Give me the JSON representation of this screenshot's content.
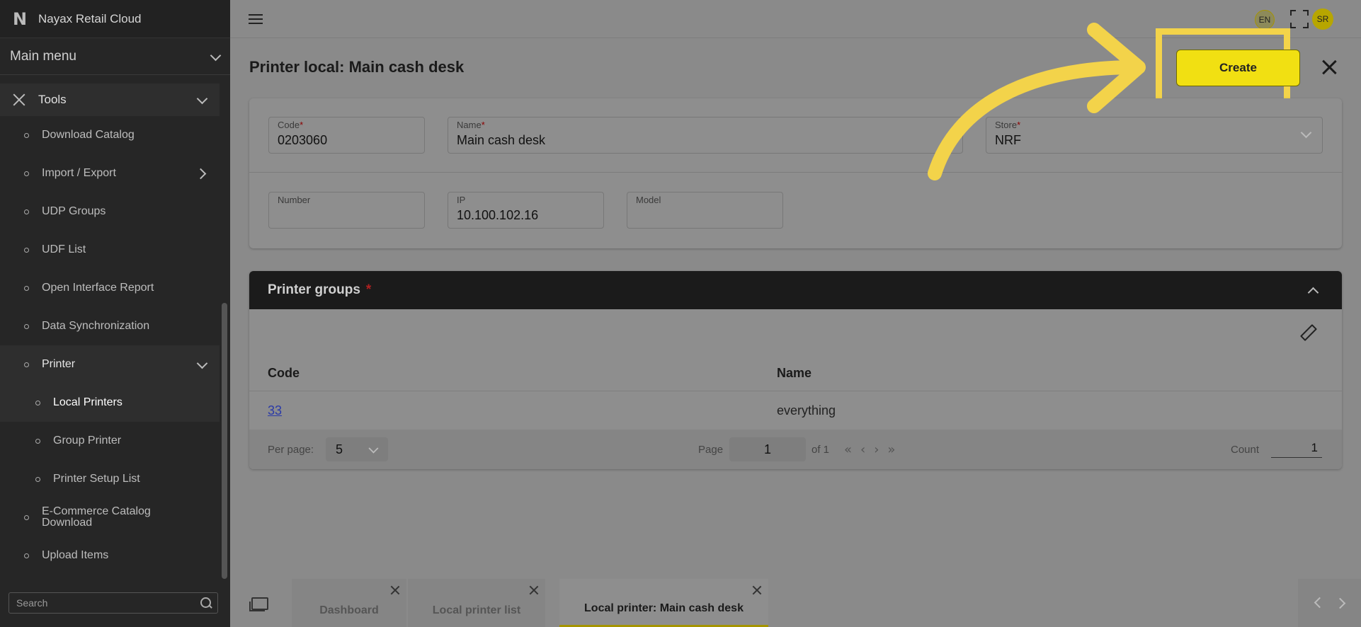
{
  "brand": {
    "name": "Nayax Retail Cloud",
    "logo_letter": "N"
  },
  "sidebar": {
    "main_menu_label": "Main menu",
    "tools_label": "Tools",
    "items": [
      {
        "label": "Download Catalog"
      },
      {
        "label": "Import / Export"
      },
      {
        "label": "UDP Groups"
      },
      {
        "label": "UDF List"
      },
      {
        "label": "Open Interface Report"
      },
      {
        "label": "Data Synchronization"
      },
      {
        "label": "Printer"
      },
      {
        "label": "Local Printers"
      },
      {
        "label": "Group Printer"
      },
      {
        "label": "Printer Setup List"
      },
      {
        "label": "E-Commerce Catalog Download"
      },
      {
        "label": "Upload Items"
      }
    ],
    "search_placeholder": "Search"
  },
  "topbar": {
    "lang": "EN",
    "avatar": "SR"
  },
  "page": {
    "title": "Printer local: Main cash desk",
    "create_label": "Create"
  },
  "form": {
    "code": {
      "label": "Code",
      "value": "0203060"
    },
    "name": {
      "label": "Name",
      "value": "Main cash desk"
    },
    "store": {
      "label": "Store",
      "value": "NRF"
    },
    "number": {
      "label": "Number",
      "value": ""
    },
    "ip": {
      "label": "IP",
      "value": "10.100.102.16"
    },
    "model": {
      "label": "Model",
      "value": ""
    },
    "required_mark": "*"
  },
  "groups": {
    "title": "Printer groups",
    "required_mark": "*",
    "columns": {
      "code": "Code",
      "name": "Name"
    },
    "rows": [
      {
        "code": "33",
        "name": "everything"
      }
    ],
    "pager": {
      "per_page_label": "Per page:",
      "per_page_value": "5",
      "page_label": "Page",
      "page_value": "1",
      "of_label": "of 1",
      "count_label": "Count",
      "count_value": "1"
    }
  },
  "tabs": [
    {
      "label": "Dashboard"
    },
    {
      "label": "Local printer list"
    },
    {
      "label": "Local printer: Main cash desk"
    }
  ],
  "colors": {
    "accent_yellow": "#f1e012",
    "highlight_yellow": "#f3d34a",
    "sidebar_bg": "#262626"
  }
}
